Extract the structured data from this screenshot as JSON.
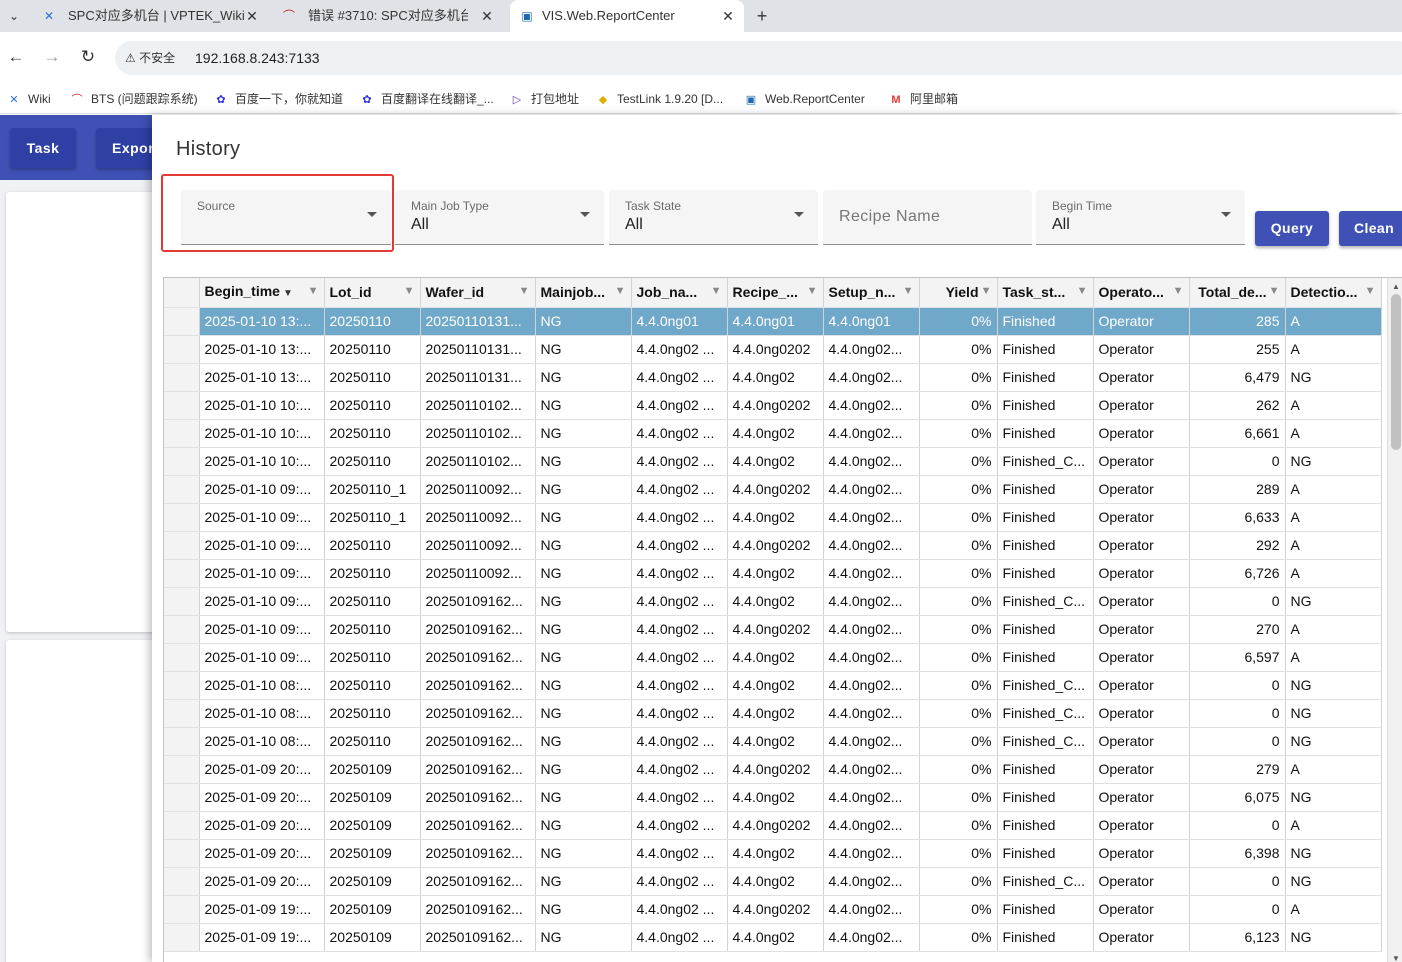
{
  "browser": {
    "tabs": [
      {
        "title": "SPC对应多机台 | VPTEK_Wiki",
        "icon": "wiki-icon"
      },
      {
        "title": "错误 #3710: SPC对应多机台 - ·",
        "icon": "bts-icon"
      },
      {
        "title": "VIS.Web.ReportCenter",
        "icon": "report-icon"
      }
    ],
    "security_label": "不安全",
    "url": "192.168.8.243:7133",
    "bookmarks": [
      "Wiki",
      "BTS (问题跟踪系统)",
      "百度一下，你就知道",
      "百度翻译在线翻译_...",
      "打包地址",
      "TestLink 1.9.20 [D...",
      "Web.ReportCenter",
      "阿里邮箱"
    ]
  },
  "app": {
    "buttons": {
      "task": "Task",
      "export": "Expor"
    }
  },
  "dialog": {
    "title": "History",
    "filters": {
      "source": {
        "label": "Source",
        "value": ""
      },
      "main_job_type": {
        "label": "Main Job Type",
        "value": "All"
      },
      "task_state": {
        "label": "Task State",
        "value": "All"
      },
      "recipe_name": {
        "placeholder": "Recipe Name"
      },
      "begin_time": {
        "label": "Begin Time",
        "value": "All"
      }
    },
    "query_label": "Query",
    "clean_label": "Clean"
  },
  "table": {
    "columns": [
      "Begin_time",
      "Lot_id",
      "Wafer_id",
      "Mainjob...",
      "Job_na...",
      "Recipe_...",
      "Setup_n...",
      "Yield",
      "Task_st...",
      "Operato...",
      "Total_de...",
      "Detectio..."
    ],
    "rows": [
      [
        "2025-01-10 13:...",
        "20250110",
        "20250110131...",
        "NG",
        "4.4.0ng01",
        "4.4.0ng01",
        "4.4.0ng01",
        "0%",
        "Finished",
        "Operator",
        "285",
        "A"
      ],
      [
        "2025-01-10 13:...",
        "20250110",
        "20250110131...",
        "NG",
        "4.4.0ng02 ...",
        "4.4.0ng0202",
        "4.4.0ng02...",
        "0%",
        "Finished",
        "Operator",
        "255",
        "A"
      ],
      [
        "2025-01-10 13:...",
        "20250110",
        "20250110131...",
        "NG",
        "4.4.0ng02 ...",
        "4.4.0ng02",
        "4.4.0ng02...",
        "0%",
        "Finished",
        "Operator",
        "6,479",
        "NG"
      ],
      [
        "2025-01-10 10:...",
        "20250110",
        "20250110102...",
        "NG",
        "4.4.0ng02 ...",
        "4.4.0ng0202",
        "4.4.0ng02...",
        "0%",
        "Finished",
        "Operator",
        "262",
        "A"
      ],
      [
        "2025-01-10 10:...",
        "20250110",
        "20250110102...",
        "NG",
        "4.4.0ng02 ...",
        "4.4.0ng02",
        "4.4.0ng02...",
        "0%",
        "Finished",
        "Operator",
        "6,661",
        "A"
      ],
      [
        "2025-01-10 10:...",
        "20250110",
        "20250110102...",
        "NG",
        "4.4.0ng02 ...",
        "4.4.0ng02",
        "4.4.0ng02...",
        "0%",
        "Finished_C...",
        "Operator",
        "0",
        "NG"
      ],
      [
        "2025-01-10 09:...",
        "20250110_1",
        "20250110092...",
        "NG",
        "4.4.0ng02 ...",
        "4.4.0ng0202",
        "4.4.0ng02...",
        "0%",
        "Finished",
        "Operator",
        "289",
        "A"
      ],
      [
        "2025-01-10 09:...",
        "20250110_1",
        "20250110092...",
        "NG",
        "4.4.0ng02 ...",
        "4.4.0ng02",
        "4.4.0ng02...",
        "0%",
        "Finished",
        "Operator",
        "6,633",
        "A"
      ],
      [
        "2025-01-10 09:...",
        "20250110",
        "20250110092...",
        "NG",
        "4.4.0ng02 ...",
        "4.4.0ng0202",
        "4.4.0ng02...",
        "0%",
        "Finished",
        "Operator",
        "292",
        "A"
      ],
      [
        "2025-01-10 09:...",
        "20250110",
        "20250110092...",
        "NG",
        "4.4.0ng02 ...",
        "4.4.0ng02",
        "4.4.0ng02...",
        "0%",
        "Finished",
        "Operator",
        "6,726",
        "A"
      ],
      [
        "2025-01-10 09:...",
        "20250110",
        "20250109162...",
        "NG",
        "4.4.0ng02 ...",
        "4.4.0ng02",
        "4.4.0ng02...",
        "0%",
        "Finished_C...",
        "Operator",
        "0",
        "NG"
      ],
      [
        "2025-01-10 09:...",
        "20250110",
        "20250109162...",
        "NG",
        "4.4.0ng02 ...",
        "4.4.0ng0202",
        "4.4.0ng02...",
        "0%",
        "Finished",
        "Operator",
        "270",
        "A"
      ],
      [
        "2025-01-10 09:...",
        "20250110",
        "20250109162...",
        "NG",
        "4.4.0ng02 ...",
        "4.4.0ng02",
        "4.4.0ng02...",
        "0%",
        "Finished",
        "Operator",
        "6,597",
        "A"
      ],
      [
        "2025-01-10 08:...",
        "20250110",
        "20250109162...",
        "NG",
        "4.4.0ng02 ...",
        "4.4.0ng02",
        "4.4.0ng02...",
        "0%",
        "Finished_C...",
        "Operator",
        "0",
        "NG"
      ],
      [
        "2025-01-10 08:...",
        "20250110",
        "20250109162...",
        "NG",
        "4.4.0ng02 ...",
        "4.4.0ng02",
        "4.4.0ng02...",
        "0%",
        "Finished_C...",
        "Operator",
        "0",
        "NG"
      ],
      [
        "2025-01-10 08:...",
        "20250110",
        "20250109162...",
        "NG",
        "4.4.0ng02 ...",
        "4.4.0ng02",
        "4.4.0ng02...",
        "0%",
        "Finished_C...",
        "Operator",
        "0",
        "NG"
      ],
      [
        "2025-01-09 20:...",
        "20250109",
        "20250109162...",
        "NG",
        "4.4.0ng02 ...",
        "4.4.0ng0202",
        "4.4.0ng02...",
        "0%",
        "Finished",
        "Operator",
        "279",
        "A"
      ],
      [
        "2025-01-09 20:...",
        "20250109",
        "20250109162...",
        "NG",
        "4.4.0ng02 ...",
        "4.4.0ng02",
        "4.4.0ng02...",
        "0%",
        "Finished",
        "Operator",
        "6,075",
        "NG"
      ],
      [
        "2025-01-09 20:...",
        "20250109",
        "20250109162...",
        "NG",
        "4.4.0ng02 ...",
        "4.4.0ng0202",
        "4.4.0ng02...",
        "0%",
        "Finished",
        "Operator",
        "0",
        "A"
      ],
      [
        "2025-01-09 20:...",
        "20250109",
        "20250109162...",
        "NG",
        "4.4.0ng02 ...",
        "4.4.0ng02",
        "4.4.0ng02...",
        "0%",
        "Finished",
        "Operator",
        "6,398",
        "NG"
      ],
      [
        "2025-01-09 20:...",
        "20250109",
        "20250109162...",
        "NG",
        "4.4.0ng02 ...",
        "4.4.0ng02",
        "4.4.0ng02...",
        "0%",
        "Finished_C...",
        "Operator",
        "0",
        "NG"
      ],
      [
        "2025-01-09 19:...",
        "20250109",
        "20250109162...",
        "NG",
        "4.4.0ng02 ...",
        "4.4.0ng0202",
        "4.4.0ng02...",
        "0%",
        "Finished",
        "Operator",
        "0",
        "A"
      ],
      [
        "2025-01-09 19:...",
        "20250109",
        "20250109162...",
        "NG",
        "4.4.0ng02 ...",
        "4.4.0ng02",
        "4.4.0ng02...",
        "0%",
        "Finished",
        "Operator",
        "6,123",
        "NG"
      ]
    ]
  },
  "colors": {
    "primary": "#3f51b5",
    "selected_row": "#6fa8c9",
    "highlight_box": "#e53935"
  }
}
